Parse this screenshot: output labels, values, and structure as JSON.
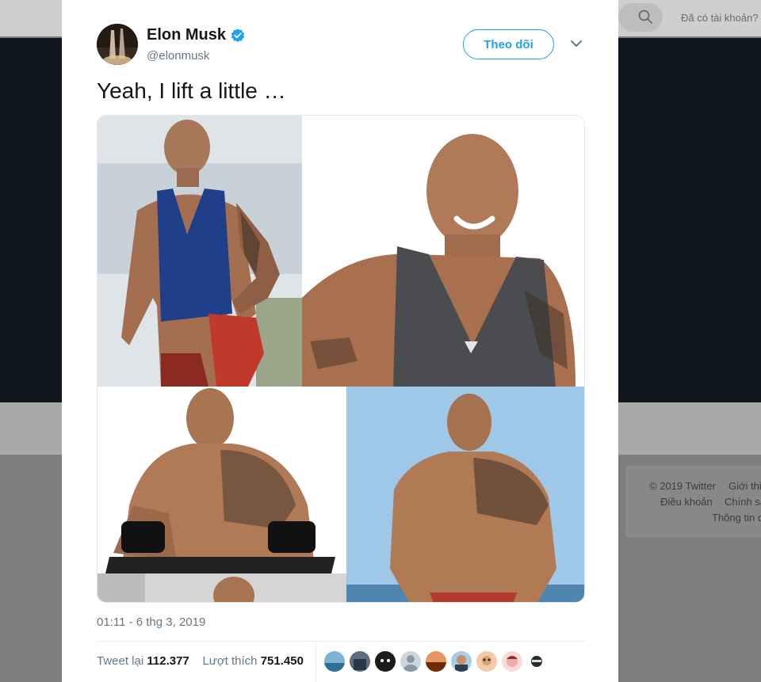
{
  "background": {
    "login_prompt": "Đã có tài khoản?",
    "footer": {
      "copyright": "© 2019 Twitter",
      "about": "Giới thi",
      "terms": "Điều khoản",
      "policy": "Chính sá",
      "info": "Thông tin c"
    }
  },
  "tweet": {
    "author_name": "Elon Musk",
    "author_handle": "@elonmusk",
    "verified": true,
    "follow_label": "Theo dõi",
    "text": "Yeah, I lift a little …",
    "timestamp": "01:11 - 6 thg 3, 2019",
    "retweets_label": "Tweet lại",
    "retweets_count": "112.377",
    "likes_label": "Lượt thích",
    "likes_count": "751.450",
    "liker_avatars": 10
  },
  "colors": {
    "accent": "#1da1f2",
    "text_primary": "#14171a",
    "text_secondary": "#657786"
  },
  "icons": [
    "search-icon",
    "verified-badge-icon",
    "chevron-down-icon"
  ]
}
